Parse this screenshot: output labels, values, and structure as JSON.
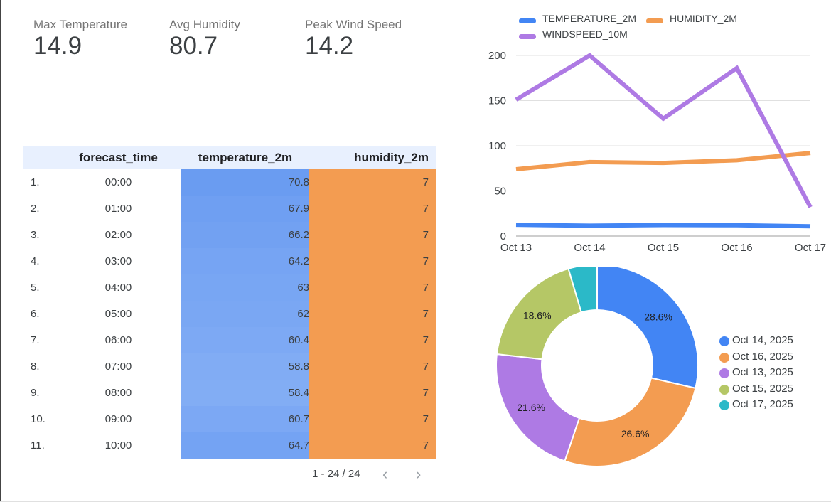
{
  "scorecards": [
    {
      "label": "Max Temperature",
      "value": "14.9"
    },
    {
      "label": "Avg Humidity",
      "value": "80.7"
    },
    {
      "label": "Peak Wind Speed",
      "value": "14.2"
    }
  ],
  "table": {
    "headers": [
      "forecast_time",
      "temperature_2m",
      "humidity_2m"
    ],
    "rows": [
      {
        "num": "1.",
        "time": "00:00",
        "temp": "70.8",
        "hum": "7"
      },
      {
        "num": "2.",
        "time": "01:00",
        "temp": "67.9",
        "hum": "7"
      },
      {
        "num": "3.",
        "time": "02:00",
        "temp": "66.2",
        "hum": "7"
      },
      {
        "num": "4.",
        "time": "03:00",
        "temp": "64.2",
        "hum": "7"
      },
      {
        "num": "5.",
        "time": "04:00",
        "temp": "63",
        "hum": "7"
      },
      {
        "num": "6.",
        "time": "05:00",
        "temp": "62",
        "hum": "7"
      },
      {
        "num": "7.",
        "time": "06:00",
        "temp": "60.4",
        "hum": "7"
      },
      {
        "num": "8.",
        "time": "07:00",
        "temp": "58.8",
        "hum": "7"
      },
      {
        "num": "9.",
        "time": "08:00",
        "temp": "58.4",
        "hum": "7"
      },
      {
        "num": "10.",
        "time": "09:00",
        "temp": "60.7",
        "hum": "7"
      },
      {
        "num": "11.",
        "time": "10:00",
        "temp": "64.7",
        "hum": "7"
      }
    ],
    "pagination": "1 - 24 / 24",
    "prev_icon": "chevron-left-icon",
    "next_icon": "chevron-right-icon",
    "colors": {
      "temp_heat": "#6d9ef0",
      "humidity_fill": "#f39c51",
      "header_bg": "#e8f0fe"
    }
  },
  "chart_data": [
    {
      "type": "line",
      "x": [
        "Oct 13",
        "Oct 14",
        "Oct 15",
        "Oct 16",
        "Oct 17"
      ],
      "series": [
        {
          "name": "TEMPERATURE_2M",
          "color": "#4285f4",
          "values": [
            12.5,
            11.5,
            12.2,
            12.0,
            10.8
          ]
        },
        {
          "name": "HUMIDITY_2M",
          "color": "#f39c51",
          "values": [
            74,
            82,
            81,
            84,
            92
          ]
        },
        {
          "name": "WINDSPEED_10M",
          "color": "#ae7ae4",
          "values": [
            151,
            200,
            130,
            186,
            32
          ]
        }
      ],
      "yticks": [
        0,
        50,
        100,
        150,
        200
      ],
      "ylim": [
        0,
        200
      ],
      "grid": true,
      "legend": "top"
    },
    {
      "type": "pie",
      "donut": true,
      "slices": [
        {
          "label": "Oct 14, 2025",
          "value": 28.6,
          "color": "#4285f4",
          "pct_label": "28.6%"
        },
        {
          "label": "Oct 16, 2025",
          "value": 26.6,
          "color": "#f39c51",
          "pct_label": "26.6%"
        },
        {
          "label": "Oct 13, 2025",
          "value": 21.6,
          "color": "#ae7ae4",
          "pct_label": "21.6%"
        },
        {
          "label": "Oct 15, 2025",
          "value": 18.6,
          "color": "#b5c766",
          "pct_label": "18.6%"
        },
        {
          "label": "Oct 17, 2025",
          "value": 4.6,
          "color": "#2bb9c8",
          "pct_label": ""
        }
      ],
      "legend": "right"
    }
  ]
}
